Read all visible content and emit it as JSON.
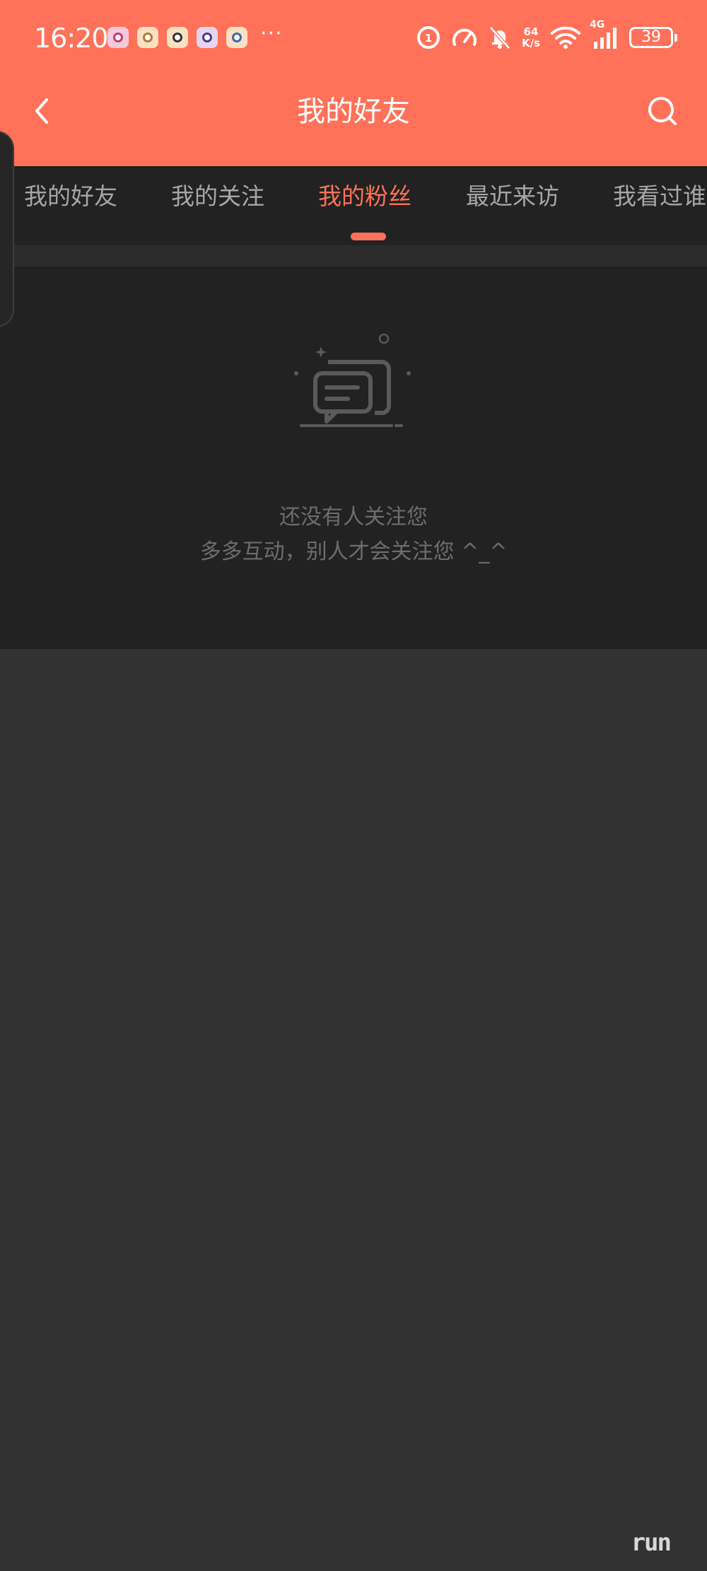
{
  "status_bar": {
    "time": "16:20",
    "more_indicator": "···",
    "network_speed_value": "64",
    "network_speed_unit": "K/s",
    "network_type": "4G",
    "battery_level": "39"
  },
  "header": {
    "title": "我的好友",
    "back_icon": "chevron-left-icon",
    "search_icon": "search-icon"
  },
  "tabs": [
    {
      "label": "我的好友",
      "active": false
    },
    {
      "label": "我的关注",
      "active": false
    },
    {
      "label": "我的粉丝",
      "active": true
    },
    {
      "label": "最近来访",
      "active": false
    },
    {
      "label": "我看过谁",
      "active": false
    }
  ],
  "empty_state": {
    "icon": "chat-bubbles-icon",
    "line1": "还没有人关注您",
    "line2": "多多互动，别人才会关注您 ^_^"
  },
  "watermark": "run",
  "colors": {
    "accent": "#ff7159",
    "tab_bar": "#222222",
    "page_bg": "#323232",
    "muted_text": "#6d6d6d"
  }
}
